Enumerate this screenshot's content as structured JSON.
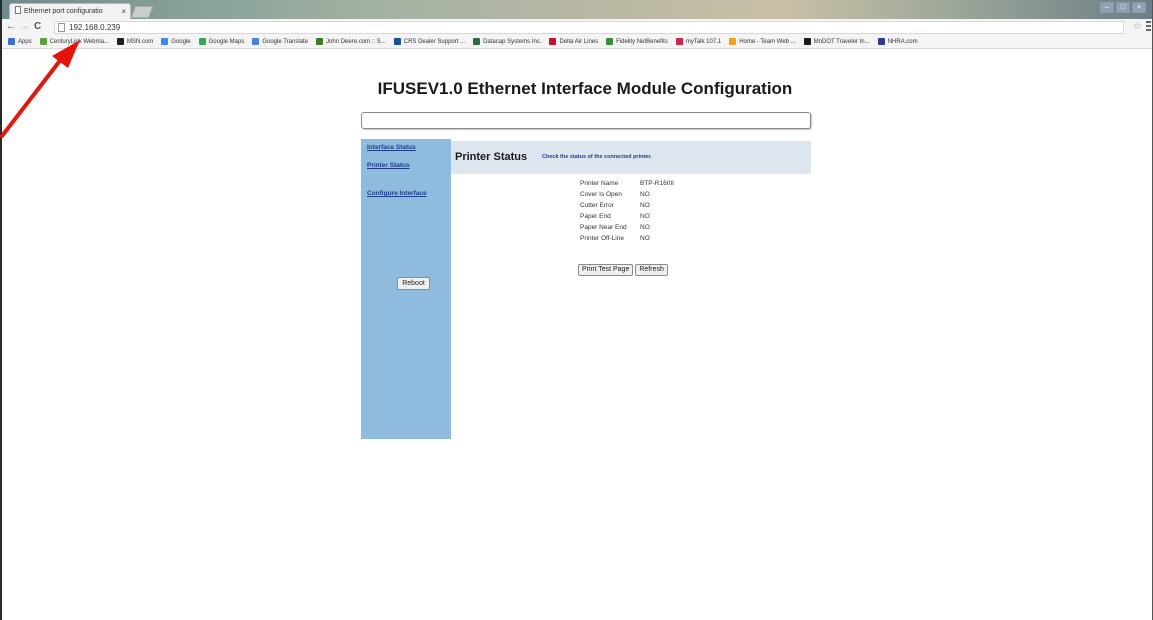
{
  "browser": {
    "tab_title": "Ethernet port configuratio",
    "tab_close": "×",
    "address": "192.168.0.239",
    "back": "←",
    "forward": "→",
    "reload": "C",
    "star": "☆",
    "window_controls": [
      "–",
      "□",
      "×"
    ],
    "bookmarks": [
      {
        "label": "Apps",
        "color": "#3a6fd8"
      },
      {
        "label": "CenturyLink Webma...",
        "color": "#58a33c"
      },
      {
        "label": "MSN.com",
        "color": "#1f1f1f"
      },
      {
        "label": "Google",
        "color": "#4285f4"
      },
      {
        "label": "Google Maps",
        "color": "#34a853"
      },
      {
        "label": "Google Translate",
        "color": "#4a7fe0"
      },
      {
        "label": "John Deere.com :: S...",
        "color": "#3d7a2a"
      },
      {
        "label": "CRS Dealer Support ...",
        "color": "#1c4f9c"
      },
      {
        "label": "Datacap Systems Inc.",
        "color": "#2d6e3e"
      },
      {
        "label": "Delta Air Lines",
        "color": "#c8102e"
      },
      {
        "label": "Fidelity NetBenefits",
        "color": "#3a8c3a"
      },
      {
        "label": "myTalk 107.1",
        "color": "#d0274a"
      },
      {
        "label": "Home - Team Web ...",
        "color": "#f0a21c"
      },
      {
        "label": "MnDOT Traveler In...",
        "color": "#1a1a1a"
      },
      {
        "label": "NHRA.com",
        "color": "#2b3d8f"
      }
    ]
  },
  "page": {
    "title": "IFUSEV1.0 Ethernet Interface Module Configuration",
    "sidebar": {
      "links": [
        {
          "label": "Interface Status"
        },
        {
          "label": "Printer Status"
        },
        {
          "label": "Configure Interface"
        }
      ],
      "reboot_label": "Reboot"
    },
    "printer_status": {
      "heading": "Printer Status",
      "description": "Check the status of the connected printer.",
      "rows": [
        {
          "label": "Printer Name",
          "value": "BTP-R160II"
        },
        {
          "label": "Cover Is Open",
          "value": "NO"
        },
        {
          "label": "Cutter Error",
          "value": "NO"
        },
        {
          "label": "Paper End",
          "value": "NO"
        },
        {
          "label": "Paper Near End",
          "value": "NO"
        },
        {
          "label": "Printer Off-Line",
          "value": "NO"
        }
      ],
      "print_test_label": "Print Test Page",
      "refresh_label": "Refresh"
    }
  },
  "colors": {
    "sidebar_bg": "#8ebbde",
    "header_band_bg": "#dde6ef",
    "link_color": "#1f3f8a",
    "annotation_arrow": "#e8140c"
  }
}
